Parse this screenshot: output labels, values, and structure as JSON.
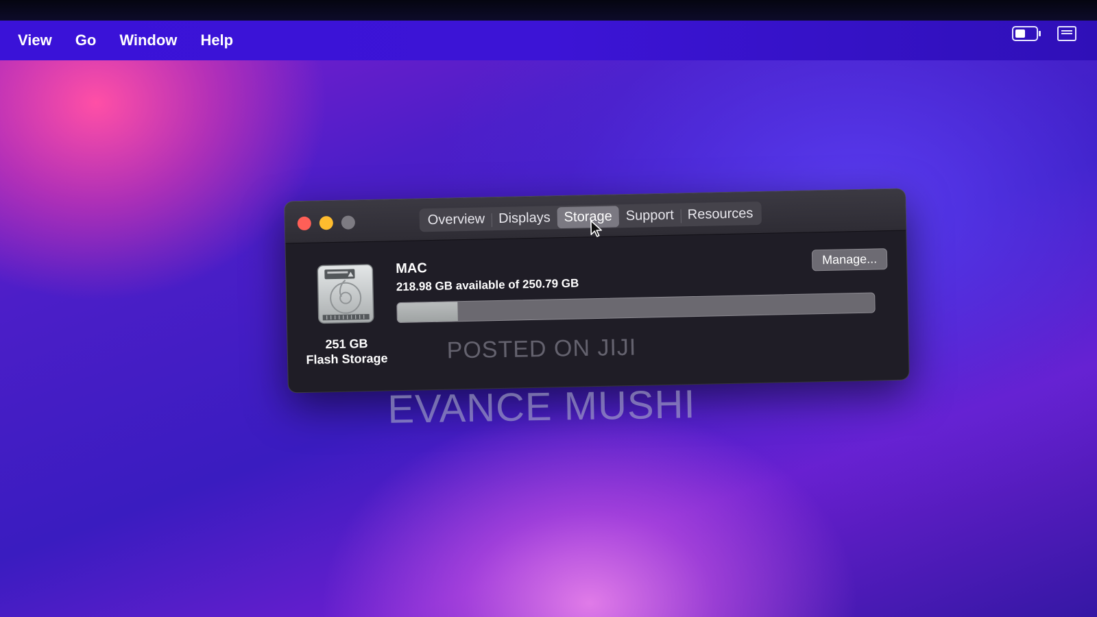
{
  "menubar": {
    "items": [
      "View",
      "Go",
      "Window",
      "Help"
    ],
    "status_icons": [
      "battery-icon",
      "control-center-icon"
    ]
  },
  "window": {
    "tabs": [
      {
        "label": "Overview",
        "active": false
      },
      {
        "label": "Displays",
        "active": false
      },
      {
        "label": "Storage",
        "active": true
      },
      {
        "label": "Support",
        "active": false
      },
      {
        "label": "Resources",
        "active": false
      }
    ],
    "storage": {
      "disk_icon": "hard-drive-icon",
      "disk_size": "251 GB",
      "disk_type": "Flash Storage",
      "volume_name": "MAC",
      "available_text": "218.98 GB available of 250.79 GB",
      "available_gb": 218.98,
      "total_gb": 250.79,
      "manage_label": "Manage..."
    }
  },
  "watermark": {
    "line1": "POSTED ON JIJI",
    "line2": "EVANCE MUSHI"
  },
  "colors": {
    "traffic_close": "#ff5f57",
    "traffic_minimize": "#febc2e",
    "traffic_zoom": "#7d7b82",
    "menubar": "#3a12d8",
    "window_bg": "#1f1d26",
    "used_segment": "#b9bcbd"
  }
}
